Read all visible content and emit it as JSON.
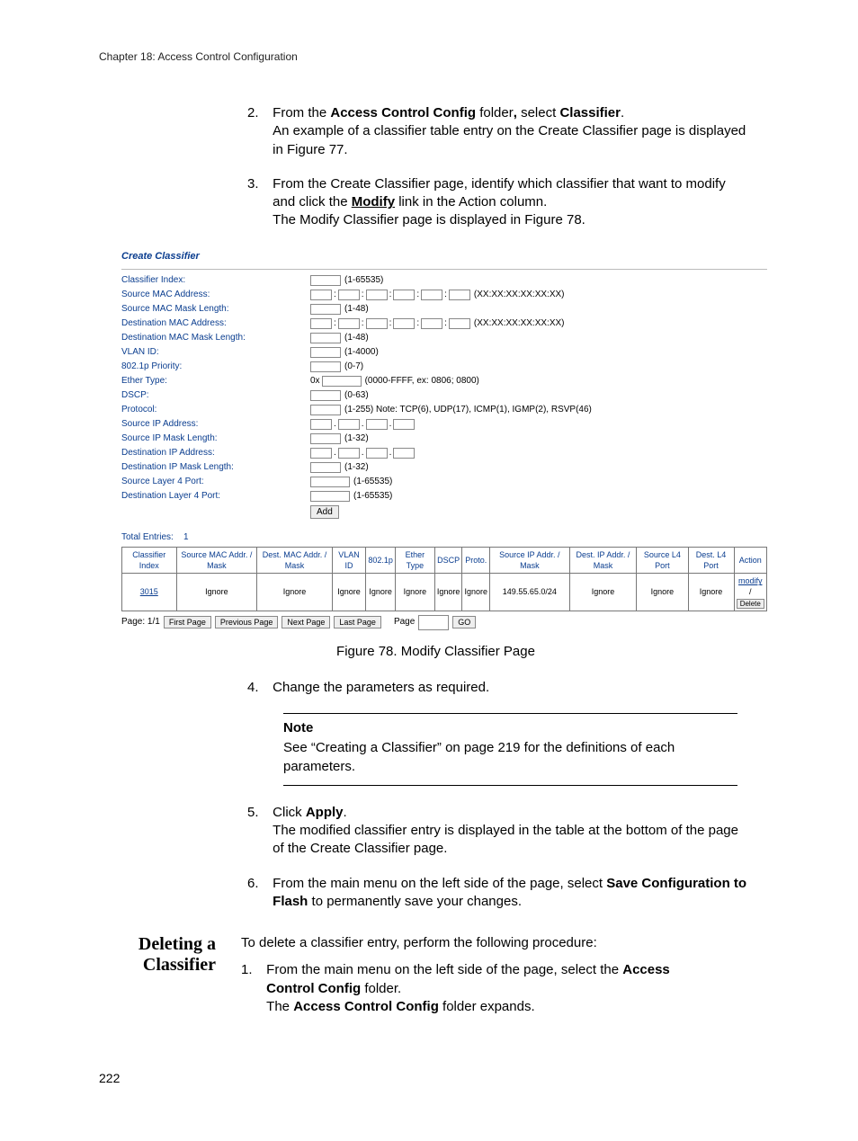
{
  "header": {
    "chapter": "Chapter 18: Access Control Configuration"
  },
  "steps_a": [
    {
      "num": "2.",
      "parts": [
        {
          "t": "From the "
        },
        {
          "t": "Access Control Config",
          "b": true
        },
        {
          "t": " folder"
        },
        {
          "t": ",",
          "b": true
        },
        {
          "t": " select "
        },
        {
          "t": "Classifier",
          "b": true
        },
        {
          "t": "."
        }
      ],
      "cont": "An example of a classifier table entry on the Create Classifier page is displayed in Figure 77."
    },
    {
      "num": "3.",
      "parts": [
        {
          "t": "From the Create Classifier page, identify which classifier that want to modify and click the "
        },
        {
          "t": "Modify",
          "b": true,
          "u": true
        },
        {
          "t": " link in the Action column."
        }
      ],
      "cont": "The Modify Classifier page is displayed in Figure 78."
    }
  ],
  "figure": {
    "title": "Create Classifier",
    "rows": [
      {
        "label": "Classifier Index:",
        "type": "single",
        "w": "w34",
        "hint": "(1-65535)"
      },
      {
        "label": "Source MAC Address:",
        "type": "mac",
        "hint": "(XX:XX:XX:XX:XX:XX)"
      },
      {
        "label": "Source MAC Mask Length:",
        "type": "single",
        "w": "w34",
        "hint": "(1-48)"
      },
      {
        "label": "Destination MAC Address:",
        "type": "mac",
        "hint": "(XX:XX:XX:XX:XX:XX)"
      },
      {
        "label": "Destination MAC Mask Length:",
        "type": "single",
        "w": "w34",
        "hint": "(1-48)"
      },
      {
        "label": "VLAN ID:",
        "type": "single",
        "w": "w34",
        "hint": "(1-4000)"
      },
      {
        "label": "802.1p Priority:",
        "type": "single",
        "w": "w34",
        "hint": "(0-7)"
      },
      {
        "label": "Ether Type:",
        "type": "hex",
        "w": "w44",
        "hint": "(0000-FFFF, ex: 0806; 0800)"
      },
      {
        "label": "DSCP:",
        "type": "single",
        "w": "w34",
        "hint": "(0-63)"
      },
      {
        "label": "Protocol:",
        "type": "single",
        "w": "w34",
        "hint": "(1-255) Note: TCP(6), UDP(17), ICMP(1), IGMP(2), RSVP(46)"
      },
      {
        "label": "Source IP Address:",
        "type": "ip"
      },
      {
        "label": "Source IP Mask Length:",
        "type": "single",
        "w": "w34",
        "hint": "(1-32)"
      },
      {
        "label": "Destination IP Address:",
        "type": "ip"
      },
      {
        "label": "Destination IP Mask Length:",
        "type": "single",
        "w": "w34",
        "hint": "(1-32)"
      },
      {
        "label": "Source Layer 4 Port:",
        "type": "single",
        "w": "w44",
        "hint": "(1-65535)"
      },
      {
        "label": "Destination Layer 4 Port:",
        "type": "single",
        "w": "w44",
        "hint": "(1-65535)"
      }
    ],
    "add_btn": "Add",
    "total_label": "Total Entries:",
    "total_value": "1",
    "table": {
      "headers": [
        "Classifier Index",
        "Source MAC Addr. / Mask",
        "Dest. MAC Addr. / Mask",
        "VLAN ID",
        "802.1p",
        "Ether Type",
        "DSCP",
        "Proto.",
        "Source IP Addr. / Mask",
        "Dest. IP Addr. / Mask",
        "Source L4 Port",
        "Dest. L4 Port",
        "Action"
      ],
      "row": {
        "idx": "3015",
        "cells": [
          "Ignore",
          "Ignore",
          "Ignore",
          "Ignore",
          "Ignore",
          "Ignore",
          "Ignore",
          "149.55.65.0/24",
          "Ignore",
          "Ignore",
          "Ignore"
        ],
        "modify": "modify",
        "delete": "Delete"
      }
    },
    "pager": {
      "label": "Page: 1/1",
      "first": "First Page",
      "prev": "Previous Page",
      "next": "Next Page",
      "last": "Last Page",
      "page_label": "Page",
      "go": "GO"
    },
    "caption": "Figure 78. Modify Classifier Page"
  },
  "steps_b": [
    {
      "num": "4.",
      "text": "Change the parameters as required."
    }
  ],
  "note": {
    "title": "Note",
    "text": "See “Creating a Classifier” on page 219 for the definitions of each parameters."
  },
  "steps_c": [
    {
      "num": "5.",
      "parts": [
        {
          "t": "Click "
        },
        {
          "t": "Apply",
          "b": true
        },
        {
          "t": "."
        }
      ],
      "cont": "The modified classifier entry is displayed in the table at the bottom of the page of the Create Classifier page."
    },
    {
      "num": "6.",
      "parts": [
        {
          "t": "From the main menu on the left side of the page, select "
        },
        {
          "t": "Save Configuration to Flash",
          "b": true
        },
        {
          "t": " to permanently save your changes."
        }
      ]
    }
  ],
  "section": {
    "title_l1": "Deleting a",
    "title_l2": "Classifier",
    "intro": "To delete a classifier entry, perform the following procedure:",
    "step": {
      "num": "1.",
      "parts": [
        {
          "t": "From the main menu on the left side of the page, select the "
        },
        {
          "t": "Access Control Config",
          "b": true
        },
        {
          "t": " folder."
        }
      ],
      "cont_parts": [
        {
          "t": "The "
        },
        {
          "t": "Access Control Config",
          "b": true
        },
        {
          "t": " folder expands."
        }
      ]
    }
  },
  "page_number": "222"
}
